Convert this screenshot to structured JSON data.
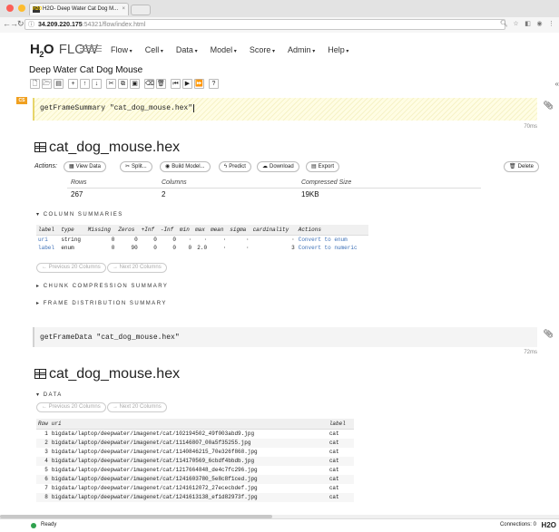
{
  "browser": {
    "tab_title": "H2O- Deep Water Cat Dog M...",
    "tab_favicon": "H2O",
    "url_host": "34.209.220.175",
    "url_path": ":54321/flow/index.html"
  },
  "app": {
    "logo_h": "H",
    "logo_sub": "2",
    "logo_o": "O",
    "logo_flow": "FLOW",
    "menu": [
      "Flow",
      "Cell",
      "Data",
      "Model",
      "Score",
      "Admin",
      "Help"
    ],
    "notebook_title": "Deep Water Cat Dog Mouse"
  },
  "cell1": {
    "badge": "CS",
    "code": "getFrameSummary \"cat_dog_mouse.hex\"",
    "timing": "70ms",
    "frame_title": "cat_dog_mouse.hex",
    "actions_label": "Actions:",
    "buttons": {
      "view_data": "View Data",
      "split": "Split...",
      "build_model": "Build Model...",
      "predict": "Predict",
      "download": "Download",
      "export": "Export",
      "delete": "Delete"
    },
    "summary": {
      "rows_label": "Rows",
      "rows": "267",
      "cols_label": "Columns",
      "cols": "2",
      "size_label": "Compressed Size",
      "size": "19KB"
    },
    "column_summaries_label": "COLUMN SUMMARIES",
    "col_headers": [
      "label",
      "type",
      "Missing",
      "Zeros",
      "+Inf",
      "-Inf",
      "min",
      "max",
      "mean",
      "sigma",
      "cardinality",
      "Actions"
    ],
    "col_rows": [
      [
        "uri",
        "string",
        "0",
        "0",
        "0",
        "0",
        "·",
        "·",
        "·",
        "·",
        "·",
        "Convert to enum"
      ],
      [
        "label",
        "enum",
        "0",
        "90",
        "0",
        "0",
        "0",
        "2.0",
        "·",
        "·",
        "3",
        "Convert to numeric"
      ]
    ],
    "prev_cols": "Previous 20 Columns",
    "next_cols": "Next 20 Columns",
    "chunk_label": "CHUNK COMPRESSION SUMMARY",
    "frame_dist_label": "FRAME DISTRIBUTION SUMMARY"
  },
  "cell2": {
    "code": "getFrameData \"cat_dog_mouse.hex\"",
    "timing": "72ms",
    "frame_title": "cat_dog_mouse.hex",
    "data_label": "DATA",
    "prev_cols": "Previous 20 Columns",
    "next_cols": "Next 20 Columns",
    "headers": [
      "Row",
      "uri",
      "label"
    ],
    "rows": [
      [
        "1",
        "bigdata/laptop/deepwater/imagenet/cat/102194502_49f003abd9.jpg",
        "cat"
      ],
      [
        "2",
        "bigdata/laptop/deepwater/imagenet/cat/11146807_00a5f35255.jpg",
        "cat"
      ],
      [
        "3",
        "bigdata/laptop/deepwater/imagenet/cat/1140846215_70e326f868.jpg",
        "cat"
      ],
      [
        "4",
        "bigdata/laptop/deepwater/imagenet/cat/114170569_6cbdf4bbdb.jpg",
        "cat"
      ],
      [
        "5",
        "bigdata/laptop/deepwater/imagenet/cat/1217664848_de4c7fc296.jpg",
        "cat"
      ],
      [
        "6",
        "bigdata/laptop/deepwater/imagenet/cat/1241603780_5e8c8f1ced.jpg",
        "cat"
      ],
      [
        "7",
        "bigdata/laptop/deepwater/imagenet/cat/1241612072_27ececbdef.jpg",
        "cat"
      ],
      [
        "8",
        "bigdata/laptop/deepwater/imagenet/cat/1241613138_ef1d82973f.jpg",
        "cat"
      ]
    ]
  },
  "status": {
    "ready": "Ready",
    "connections_label": "Connections:",
    "connections": "0",
    "brand": "H2O"
  },
  "colors": {
    "accent_link": "#3b6fb6",
    "badge": "#f0a020",
    "ready_dot": "#2fa14e"
  }
}
